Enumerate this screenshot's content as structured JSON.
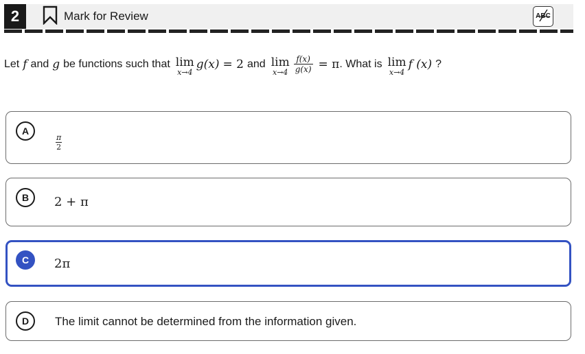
{
  "header": {
    "question_number": "2",
    "mark_label": "Mark for Review",
    "abc_label": "ABC"
  },
  "question": {
    "p1": "Let",
    "f": "f",
    "p2": "and",
    "g": "g",
    "p3": "be functions such that",
    "lim_word": "lim",
    "lim_sub": "x→4",
    "g_of_x": "g(x)",
    "eq_2": "= 2",
    "p4": "and",
    "frac_num": "f(x)",
    "frac_den": "g(x)",
    "eq_pi": "= π",
    "p5": ". What is",
    "f_of_x": "f (x)",
    "p6": "?"
  },
  "choices": [
    {
      "letter": "A",
      "num": "π",
      "den": "2",
      "selected": false
    },
    {
      "letter": "B",
      "text": "2 + π",
      "selected": false
    },
    {
      "letter": "C",
      "text": "2π",
      "selected": true
    },
    {
      "letter": "D",
      "text": "The limit cannot be determined from the information given.",
      "selected": false
    }
  ],
  "colors": {
    "accent": "#3352c2",
    "header_bg": "#f0f0f0",
    "question_number_bg": "#1a1a1a"
  },
  "icons": {
    "bookmark": "bookmark-outline-icon",
    "abc": "abc-strikethrough-icon"
  }
}
